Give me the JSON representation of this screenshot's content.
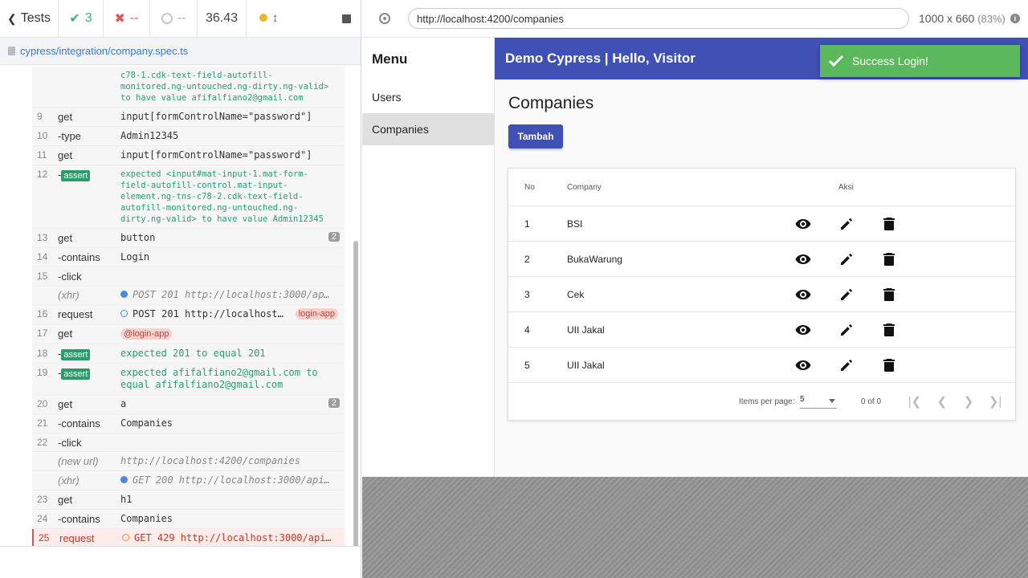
{
  "reporter": {
    "tests_label": "Tests",
    "passed": "3",
    "failed": "--",
    "pending": "--",
    "duration": "36.43",
    "spec_path": "cypress/integration/company.spec.ts"
  },
  "commands": [
    {
      "num": "",
      "name": "",
      "msg": "c78-1.cdk-text-field-autofill-monitored.ng-untouched.ng-dirty.ng-valid> to have value afifalfiano2@gmail.com",
      "kind": "continuation"
    },
    {
      "num": "9",
      "name": "get",
      "msg": "input[formControlName=\"password\"]"
    },
    {
      "num": "10",
      "name": "-type",
      "msg": "Admin12345"
    },
    {
      "num": "11",
      "name": "get",
      "msg": "input[formControlName=\"password\"]"
    },
    {
      "num": "12",
      "name": "-",
      "badge": "assert",
      "msg": "expected <input#mat-input-1.mat-form-field-autofill-control.mat-input-element.ng-tns-c78-2.cdk-text-field-autofill-monitored.ng-untouched.ng-dirty.ng-valid> to have value Admin12345",
      "kind": "small"
    },
    {
      "num": "13",
      "name": "get",
      "msg": "button",
      "count": "2"
    },
    {
      "num": "14",
      "name": "-contains",
      "msg": "Login"
    },
    {
      "num": "15",
      "name": "-click",
      "msg": ""
    },
    {
      "num": "",
      "name": "(xhr)",
      "msg": "POST 201 http://localhost:3000/ap…",
      "kind": "xhr"
    },
    {
      "num": "16",
      "name": "request",
      "msg": "POST 201 http://localhost…",
      "kind": "request",
      "alias": "login-app"
    },
    {
      "num": "17",
      "name": "get",
      "msg": "",
      "alias_inline": "@login-app"
    },
    {
      "num": "18",
      "name": "-",
      "badge": "assert",
      "msg": "expected 201 to equal 201",
      "kind": "green"
    },
    {
      "num": "19",
      "name": "-",
      "badge": "assert",
      "msg": "expected afifalfiano2@gmail.com to equal afifalfiano2@gmail.com",
      "kind": "green"
    },
    {
      "num": "20",
      "name": "get",
      "msg": "a",
      "count": "2"
    },
    {
      "num": "21",
      "name": "-contains",
      "msg": "Companies"
    },
    {
      "num": "22",
      "name": "-click",
      "msg": ""
    },
    {
      "num": "",
      "name": "(new url)",
      "msg": "http://localhost:4200/companies",
      "kind": "newurl"
    },
    {
      "num": "",
      "name": "(xhr)",
      "msg": "GET 200 http://localhost:3000/api…",
      "kind": "xhr"
    },
    {
      "num": "23",
      "name": "get",
      "msg": "h1"
    },
    {
      "num": "24",
      "name": "-contains",
      "msg": "Companies"
    },
    {
      "num": "25",
      "name": "request",
      "msg": "GET 429 http://localhost:3000/api…",
      "kind": "failed"
    }
  ],
  "aut": {
    "url": "http://localhost:4200/companies",
    "viewport": "1000 x 660",
    "scale": "(83%)"
  },
  "app": {
    "menu_title": "Menu",
    "nav": [
      {
        "label": "Users"
      },
      {
        "label": "Companies"
      }
    ],
    "toolbar_title": "Demo Cypress |  Hello, Visitor",
    "page_title": "Companies",
    "add_button": "Tambah",
    "table": {
      "headers": {
        "no": "No",
        "company": "Company",
        "actions": "Aksi"
      },
      "rows": [
        {
          "no": "1",
          "company": "BSI"
        },
        {
          "no": "2",
          "company": "BukaWarung"
        },
        {
          "no": "3",
          "company": "Cek"
        },
        {
          "no": "4",
          "company": "UII Jakal"
        },
        {
          "no": "5",
          "company": "UII Jakal"
        }
      ]
    },
    "paginator": {
      "label": "Items per page:",
      "page_size": "5",
      "range": "0 of 0"
    },
    "toast": "Success Login!"
  },
  "colors": {
    "primary": "#3f51b5",
    "success": "#5cb85c",
    "pass": "#3bb47a",
    "fail": "#e05556"
  }
}
